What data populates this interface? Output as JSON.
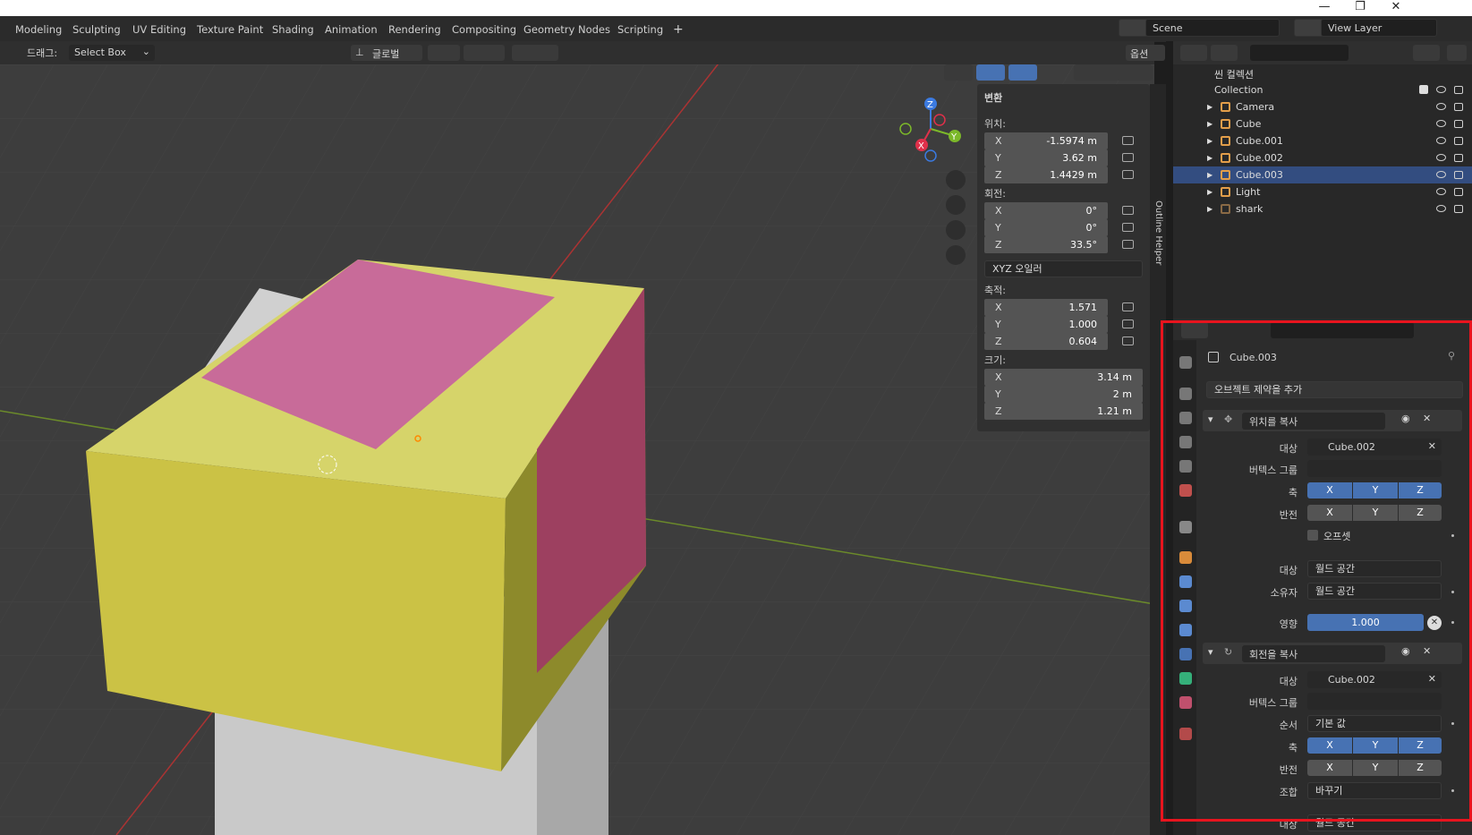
{
  "workspace_tabs": [
    "Modeling",
    "Sculpting",
    "UV Editing",
    "Texture Paint",
    "Shading",
    "Animation",
    "Rendering",
    "Compositing",
    "Geometry Nodes",
    "Scripting"
  ],
  "scene": "Scene",
  "view_layer": "View Layer",
  "header": {
    "drag_label": "드래그:",
    "select_mode": "Select Box",
    "orientation": "글로벌",
    "options": "옵션"
  },
  "transform": {
    "title": "변환",
    "location_label": "위치:",
    "location": [
      {
        "axis": "X",
        "value": "-1.5974 m"
      },
      {
        "axis": "Y",
        "value": "3.62 m"
      },
      {
        "axis": "Z",
        "value": "1.4429 m"
      }
    ],
    "rotation_label": "회전:",
    "rotation": [
      {
        "axis": "X",
        "value": "0°"
      },
      {
        "axis": "Y",
        "value": "0°"
      },
      {
        "axis": "Z",
        "value": "33.5°"
      }
    ],
    "rotation_mode": "XYZ 오일러",
    "scale_label": "축적:",
    "scale": [
      {
        "axis": "X",
        "value": "1.571"
      },
      {
        "axis": "Y",
        "value": "1.000"
      },
      {
        "axis": "Z",
        "value": "0.604"
      }
    ],
    "dimensions_label": "크기:",
    "dimensions": [
      {
        "axis": "X",
        "value": "3.14 m"
      },
      {
        "axis": "Y",
        "value": "2 m"
      },
      {
        "axis": "Z",
        "value": "1.21 m"
      }
    ]
  },
  "side_tabs": [
    "Outline Helper"
  ],
  "outliner": {
    "root": "씬 컬렉션",
    "collection": "Collection",
    "items": [
      {
        "name": "Camera",
        "icon": "camera-icon",
        "color": "#e39e4a"
      },
      {
        "name": "Cube",
        "icon": "mesh-icon",
        "color": "#e39e4a"
      },
      {
        "name": "Cube.001",
        "icon": "mesh-icon",
        "color": "#e39e4a"
      },
      {
        "name": "Cube.002",
        "icon": "mesh-icon",
        "color": "#e39e4a"
      },
      {
        "name": "Cube.003",
        "icon": "mesh-icon",
        "color": "#e39e4a"
      },
      {
        "name": "Light",
        "icon": "light-icon",
        "color": "#e39e4a"
      },
      {
        "name": "shark",
        "icon": "mesh-icon",
        "color": "#8a6a45"
      }
    ]
  },
  "properties": {
    "object_name": "Cube.003",
    "add_constraint": "오브젝트 제약을 추가",
    "constraint1": {
      "name": "위치를 복사",
      "target_label": "대상",
      "target": "Cube.002",
      "vgroup_label": "버텍스 그룹",
      "axis_label": "축",
      "invert_label": "반전",
      "offset_label": "오프셋",
      "target_space_label": "대상",
      "target_space": "월드 공간",
      "owner_space_label": "소유자",
      "owner_space": "월드 공간",
      "influence_label": "영향",
      "influence": "1.000"
    },
    "constraint2": {
      "name": "회전을 복사",
      "target_label": "대상",
      "target": "Cube.002",
      "vgroup_label": "버텍스 그룹",
      "order_label": "순서",
      "order": "기본 값",
      "axis_label": "축",
      "invert_label": "반전",
      "mix_label": "조합",
      "mix": "바꾸기",
      "target_space_label": "대상",
      "target_space": "월드 공간"
    },
    "axes": [
      "X",
      "Y",
      "Z"
    ]
  },
  "colors": {
    "accent": "#4772b3",
    "highlight": "#e8141e"
  }
}
